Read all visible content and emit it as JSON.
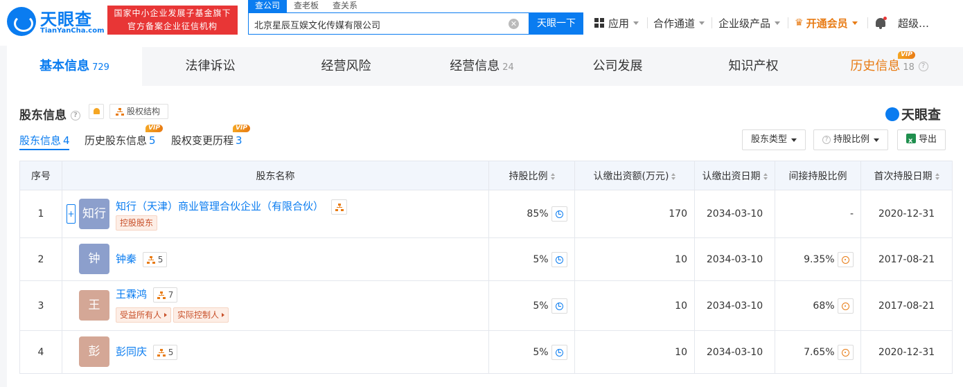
{
  "header": {
    "logo_text": "天眼查",
    "logo_sub": "TianYanCha.com",
    "banner_line1": "国家中小企业发展子基金旗下",
    "banner_line2": "官方备案企业征信机构",
    "search_tabs": [
      "查公司",
      "查老板",
      "查关系"
    ],
    "search_value": "北京星辰互娱文化传媒有限公司",
    "search_button": "天眼一下",
    "nav": {
      "apps": "应用",
      "channels": "合作通道",
      "enterprise": "企业级产品",
      "vip": "开通会员",
      "user": "超级…"
    }
  },
  "main_tabs": [
    {
      "label": "基本信息",
      "count": "729"
    },
    {
      "label": "法律诉讼",
      "count": ""
    },
    {
      "label": "经营风险",
      "count": ""
    },
    {
      "label": "经营信息",
      "count": "24"
    },
    {
      "label": "公司发展",
      "count": ""
    },
    {
      "label": "知识产权",
      "count": ""
    },
    {
      "label": "历史信息",
      "count": "18",
      "badge": "VIP"
    }
  ],
  "section": {
    "title": "股东信息",
    "equity_button": "股权结构",
    "brand": "天眼查",
    "sub_tabs": [
      {
        "label": "股东信息",
        "count": "4"
      },
      {
        "label": "历史股东信息",
        "count": "5",
        "badge": "VIP"
      },
      {
        "label": "股权变更历程",
        "count": "3",
        "badge": "VIP"
      }
    ],
    "tools": {
      "type_filter": "股东类型",
      "ratio_filter": "持股比例",
      "export": "导出"
    }
  },
  "table": {
    "headers": {
      "index": "序号",
      "name": "股东名称",
      "ratio": "持股比例",
      "amount": "认缴出资额(万元)",
      "date": "认缴出资日期",
      "indirect": "间接持股比例",
      "first_date": "首次持股日期"
    },
    "rows": [
      {
        "index": "1",
        "avatar": "知行",
        "name": "知行（天津）商业管理合伙企业（有限合伙）",
        "tags": [
          "控股股东"
        ],
        "related": "",
        "ratio": "85%",
        "amount": "170",
        "date": "2034-03-10",
        "indirect": "-",
        "first_date": "2020-12-31",
        "avatar_color": "#8c9fcc"
      },
      {
        "index": "2",
        "avatar": "钟",
        "name": "钟秦",
        "tags": [],
        "related": "5",
        "ratio": "5%",
        "amount": "10",
        "date": "2034-03-10",
        "indirect": "9.35%",
        "first_date": "2017-08-21",
        "avatar_color": "#8c9fcc"
      },
      {
        "index": "3",
        "avatar": "王",
        "name": "王霖鸿",
        "tags": [
          "受益所有人",
          "实际控制人"
        ],
        "related": "7",
        "ratio": "5%",
        "amount": "10",
        "date": "2034-03-10",
        "indirect": "68%",
        "first_date": "2017-08-21",
        "avatar_color": "#d4a796"
      },
      {
        "index": "4",
        "avatar": "彭",
        "name": "彭同庆",
        "tags": [],
        "related": "5",
        "ratio": "5%",
        "amount": "10",
        "date": "2034-03-10",
        "indirect": "7.65%",
        "first_date": "2020-12-31",
        "avatar_color": "#d4a796"
      }
    ]
  },
  "colors": {
    "brand": "#0a7cf0",
    "vip": "#e87b14",
    "banner": "#e83636"
  }
}
